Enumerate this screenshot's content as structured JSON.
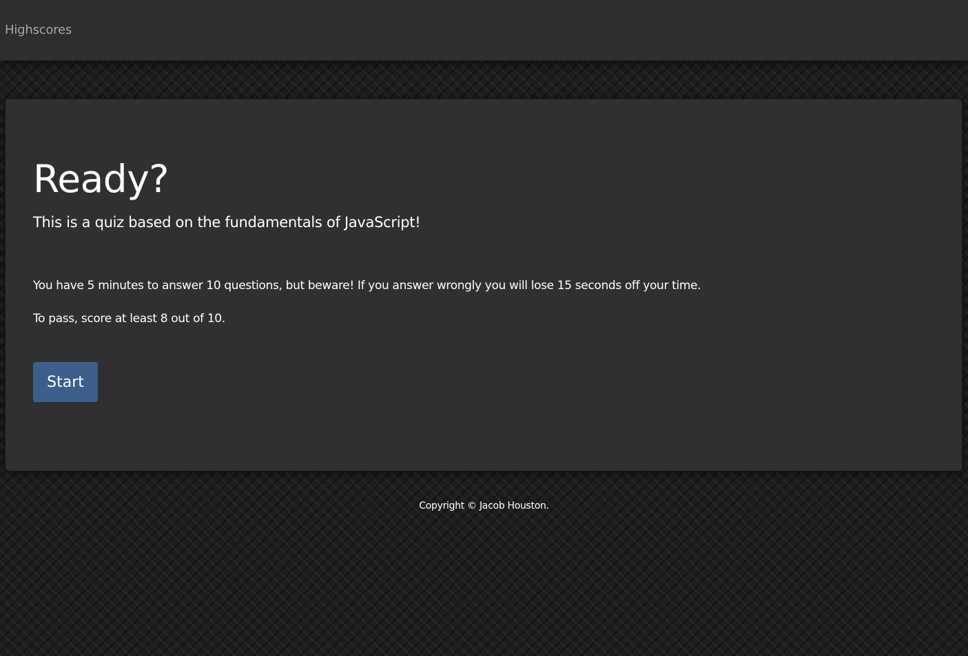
{
  "nav": {
    "highscores_label": "Highscores"
  },
  "quiz_intro": {
    "title": "Ready?",
    "subtitle": "This is a quiz based on the fundamentals of JavaScript!",
    "rules": "You have 5 minutes to answer 10 questions, but beware! If you answer wrongly you will lose 15 seconds off your time.",
    "pass_requirement": "To pass, score at least 8 out of 10.",
    "start_label": "Start"
  },
  "footer": {
    "copyright": "Copyright © Jacob Houston."
  },
  "colors": {
    "navbar_bg": "#2e2e2f",
    "card_bg": "#303031",
    "page_bg": "#1d1d1e",
    "button_bg": "#3b5f8a",
    "nav_link": "#a6a6a6",
    "text": "#ffffff"
  }
}
